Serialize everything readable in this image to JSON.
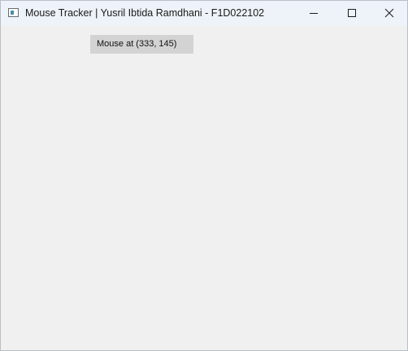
{
  "window": {
    "title": "Mouse Tracker | Yusril Ibtida Ramdhani - F1D022102",
    "app_icon": "window-app-icon",
    "controls": {
      "minimize_icon": "minimize-icon",
      "maximize_icon": "maximize-icon",
      "close_icon": "close-icon"
    }
  },
  "content": {
    "mouse_label": "Mouse at (333, 145)"
  },
  "colors": {
    "titlebar_bg": "#eef3f9",
    "client_bg": "#f0f0f0",
    "label_bg": "#d3d3d3"
  }
}
